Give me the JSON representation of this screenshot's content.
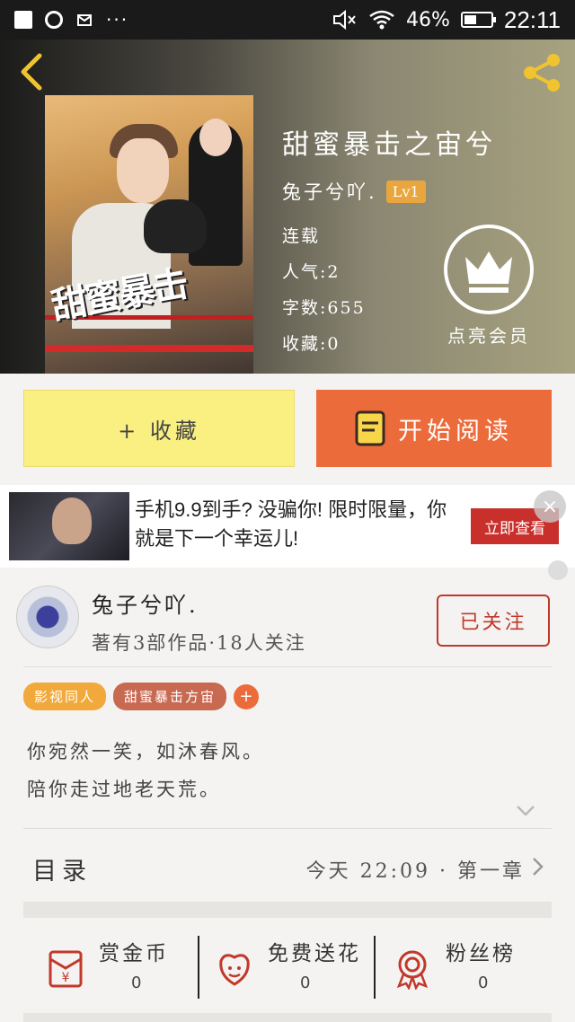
{
  "status_bar": {
    "battery": "46%",
    "battery_level": 0.46,
    "time": "22:11",
    "more": "···"
  },
  "header": {
    "cover_text": "甜蜜暴击",
    "book_title": "甜蜜暴击之宙兮",
    "author_name": "兔子兮吖.",
    "level": "Lv1",
    "status": "连载",
    "popularity": "人气:2",
    "word_count": "字数:655",
    "favorites": "收藏:0",
    "vip_label": "点亮会员"
  },
  "actions": {
    "collect_label": "+ 收藏",
    "read_label": "开始阅读"
  },
  "ad": {
    "text": "手机9.9到手? 没骗你! 限时限量，你就是下一个幸运儿!",
    "cta": "立即查看",
    "close": "×"
  },
  "author": {
    "name": "兔子兮吖.",
    "subtitle": "著有3部作品·18人关注",
    "follow_label": "已关注"
  },
  "tags": [
    {
      "label": "影视同人",
      "color": "#f2a93b"
    },
    {
      "label": "甜蜜暴击方宙",
      "color": "#c86a52"
    }
  ],
  "tag_add": "+",
  "description": {
    "line1": "你宛然一笑，如沐春风。",
    "line2": "陪你走过地老天荒。"
  },
  "catalog": {
    "title": "目录",
    "latest": "今天 22:09 · 第一章"
  },
  "stats": [
    {
      "label": "赏金币",
      "value": "0",
      "icon": "red-envelope-icon"
    },
    {
      "label": "免费送花",
      "value": "0",
      "icon": "flower-icon"
    },
    {
      "label": "粉丝榜",
      "value": "0",
      "icon": "medal-icon"
    }
  ],
  "colors": {
    "accent_orange": "#ec6b3b",
    "collect_yellow": "#faf081",
    "follow_red": "#c0392b",
    "level_badge": "#e9a53e"
  }
}
